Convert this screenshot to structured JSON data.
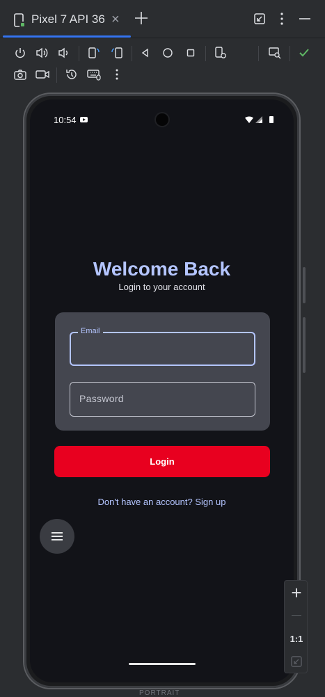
{
  "tab": {
    "title": "Pixel 7 API 36",
    "close": "×"
  },
  "device": {
    "status_time": "10:54",
    "welcome_title": "Welcome Back",
    "welcome_subtitle": "Login to your account",
    "email_label": "Email",
    "email_value": "",
    "password_placeholder": "Password",
    "login_label": "Login",
    "signup_text": "Don't have an account? Sign up"
  },
  "zoom": {
    "plus": "+",
    "minus": "—",
    "actual_size": "1:1"
  },
  "bottom_label": "PORTRAIT",
  "colors": {
    "accent": "#b4c5ff",
    "login_button": "#e8001f",
    "tab_indicator": "#3574f0",
    "run_check": "#5fb865"
  }
}
